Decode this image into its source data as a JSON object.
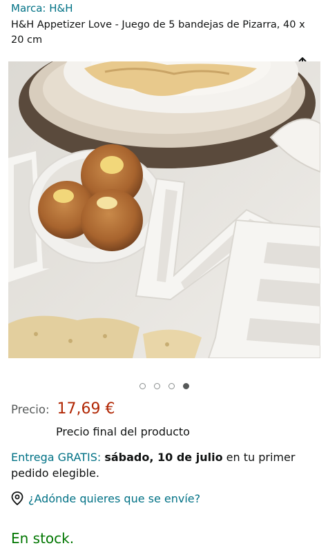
{
  "brand": {
    "label": "Marca: H&H"
  },
  "product": {
    "title": "H&H Appetizer Love - Juego de 5 bandejas de Pizarra, 40 x 20 cm"
  },
  "share": {
    "icon": "share-icon"
  },
  "image": {
    "description": "Bandejas de cerámica blanca con forma de letras LOVE con dulces",
    "dots": 4,
    "active_dot": 4
  },
  "price": {
    "label": "Precio:",
    "value": "17,69 €",
    "note": "Precio final del producto"
  },
  "delivery": {
    "prefix": "Entrega GRATIS:",
    "date": "sábado, 10 de julio",
    "suffix": " en tu primer pedido elegible."
  },
  "location": {
    "icon": "location-pin-icon",
    "label": "¿Adónde quieres que se envíe?"
  },
  "stock": {
    "label": "En stock."
  },
  "colors": {
    "link": "#007185",
    "price": "#b12704",
    "stock": "#007600",
    "text": "#0f1111"
  }
}
